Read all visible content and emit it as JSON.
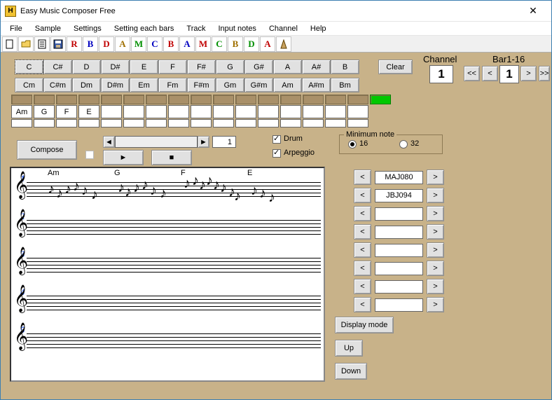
{
  "title": "Easy Music Composer Free",
  "menu": [
    "File",
    "Sample",
    "Settings",
    "Setting each bars",
    "Track",
    "Input notes",
    "Channel",
    "Help"
  ],
  "toolbar_letters": [
    {
      "t": "R",
      "c": "#c00000"
    },
    {
      "t": "B",
      "c": "#0000c0"
    },
    {
      "t": "D",
      "c": "#c00000"
    },
    {
      "t": "A",
      "c": "#a07000"
    },
    {
      "t": "M",
      "c": "#009000"
    },
    {
      "t": "C",
      "c": "#0000c0"
    },
    {
      "t": "B",
      "c": "#c00000"
    },
    {
      "t": "A",
      "c": "#0000c0"
    },
    {
      "t": "M",
      "c": "#c00000"
    },
    {
      "t": "C",
      "c": "#009000"
    },
    {
      "t": "B",
      "c": "#a07000"
    },
    {
      "t": "D",
      "c": "#009000"
    },
    {
      "t": "A",
      "c": "#c00000"
    }
  ],
  "major_chords": [
    "C",
    "C#",
    "D",
    "D#",
    "E",
    "F",
    "F#",
    "G",
    "G#",
    "A",
    "A#",
    "B"
  ],
  "minor_chords": [
    "Cm",
    "C#m",
    "Dm",
    "D#m",
    "Em",
    "Fm",
    "F#m",
    "Gm",
    "G#m",
    "Am",
    "A#m",
    "Bm"
  ],
  "clear": "Clear",
  "channel_label": "Channel",
  "channel_value": "1",
  "bar_label": "Bar1-16",
  "page_value": "1",
  "bar_slots": [
    "Am",
    "G",
    "F",
    "E",
    "",
    "",
    "",
    "",
    "",
    "",
    "",
    "",
    "",
    "",
    "",
    ""
  ],
  "compose": "Compose",
  "spin_value": "1",
  "drum_label": "Drum",
  "arpeggio_label": "Arpeggio",
  "min_note_label": "Minimum note",
  "radio16": "16",
  "radio32": "32",
  "patterns": [
    "MAJ080",
    "JBJ094",
    "",
    "",
    "",
    "",
    "",
    ""
  ],
  "display_mode": "Display mode",
  "up": "Up",
  "down": "Down",
  "staff_chords": [
    "Am",
    "G",
    "F",
    "E"
  ]
}
